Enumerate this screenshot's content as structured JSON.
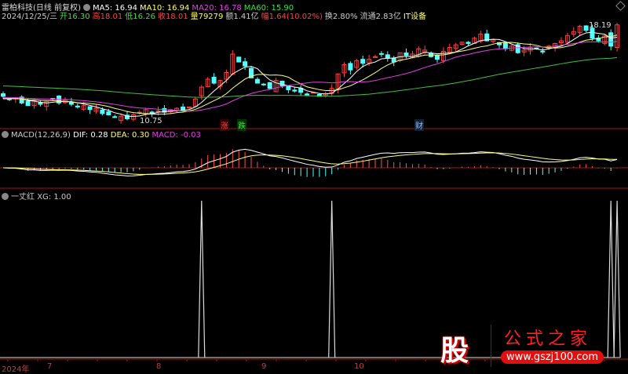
{
  "header": {
    "title": "雷柏科技(日线 前复权)",
    "ma5": "MA5: 16.94",
    "ma10": "MA10: 16.94",
    "ma20": "MA20: 16.78",
    "ma60": "MA60: 15.90",
    "date": "2024/12/25/三",
    "open_label": "开",
    "open": "16.30",
    "high_label": "高",
    "high": "18.01",
    "low_label": "低",
    "low": "16.26",
    "close_label": "收",
    "close": "18.01",
    "vol_label": "量",
    "vol": "79279",
    "amount": "额1.41亿",
    "chg_label": "幅",
    "chg": "1.64(10.02%)",
    "turnover": "换2.80%",
    "float": "流通2.83亿",
    "sector": "IT设备"
  },
  "macd_panel": {
    "title": "MACD(12,26,9)",
    "dif": "DIF: 0.28",
    "dea": "DEA: 0.30",
    "macd": "MACD: -0.03"
  },
  "xg_panel": {
    "title": "一丈红",
    "xg": "XG: 1.00"
  },
  "markers": {
    "zhang": "涨",
    "die": "跌",
    "cai": "财",
    "high_label": "18.19",
    "low_label": "10.75"
  },
  "axis": {
    "labels": [
      "2024年",
      "7",
      "8",
      "9",
      "10"
    ]
  },
  "logo": {
    "glyph": "股",
    "name": "公式之家",
    "url": "www.gszj100.com"
  },
  "colors": {
    "up": "#ff4040",
    "down": "#54ffff",
    "ma5": "#ffffff",
    "ma10": "#ffff80",
    "ma20": "#e040e0",
    "ma60": "#40c040",
    "panel_line": "#a01818"
  },
  "chart_data": {
    "type": "candlestick",
    "title": "雷柏科技(日线 前复权)",
    "closes": [
      12.6,
      12.4,
      12.5,
      12.1,
      11.9,
      12.3,
      12.0,
      12.2,
      12.4,
      12.1,
      12.3,
      12.0,
      11.8,
      11.9,
      11.6,
      11.7,
      11.3,
      11.2,
      11.0,
      11.1,
      10.9,
      11.2,
      11.4,
      11.6,
      11.3,
      11.5,
      11.4,
      11.6,
      11.7,
      11.5,
      11.8,
      12.4,
      13.3,
      13.9,
      13.6,
      13.8,
      14.4,
      15.8,
      15.2,
      14.9,
      14.0,
      13.6,
      13.5,
      13.2,
      13.8,
      13.4,
      13.1,
      13.0,
      12.9,
      12.7,
      12.9,
      12.6,
      12.8,
      13.2,
      14.3,
      15.0,
      14.6,
      15.3,
      15.1,
      15.4,
      15.6,
      15.8,
      15.5,
      15.2,
      15.9,
      15.7,
      15.8,
      16.2,
      16.1,
      15.6,
      15.4,
      16.0,
      16.3,
      16.5,
      16.7,
      16.6,
      17.0,
      17.3,
      16.8,
      16.9,
      16.5,
      16.2,
      16.4,
      15.9,
      16.1,
      16.3,
      16.2,
      16.0,
      16.4,
      16.6,
      16.8,
      17.2,
      17.5,
      17.9,
      17.6,
      17.0,
      16.8,
      17.2,
      16.4,
      18.01
    ],
    "price_range": [
      10.4,
      19.0
    ],
    "xg_signals": [
      32,
      53,
      98,
      99
    ],
    "xg_range": [
      0,
      1
    ]
  }
}
